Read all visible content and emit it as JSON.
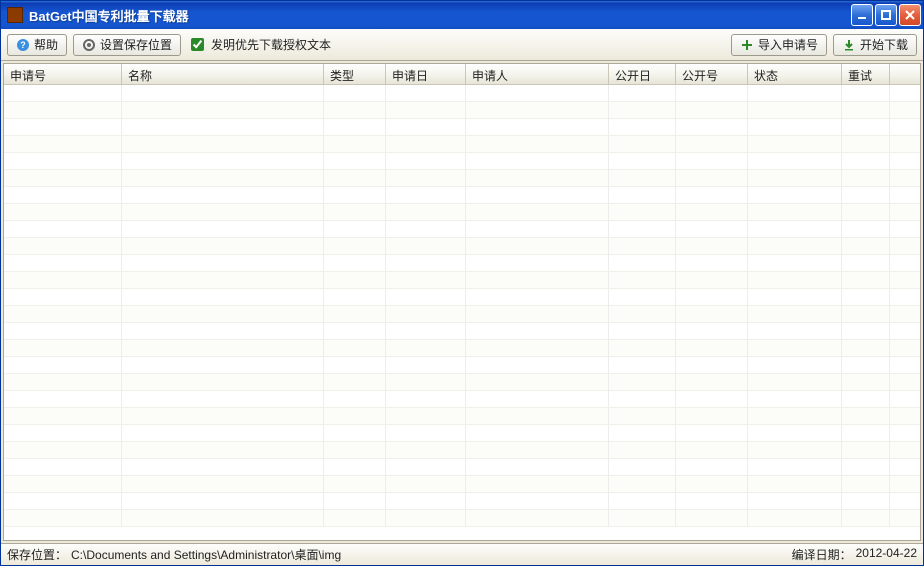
{
  "title": "BatGet中国专利批量下载器",
  "toolbar": {
    "help_label": "帮助",
    "set_path_label": "设置保存位置",
    "checkbox_label": "发明优先下载授权文本",
    "checkbox_checked": true,
    "import_label": "导入申请号",
    "start_label": "开始下载"
  },
  "columns": [
    {
      "label": "申请号"
    },
    {
      "label": "名称"
    },
    {
      "label": "类型"
    },
    {
      "label": "申请日"
    },
    {
      "label": "申请人"
    },
    {
      "label": "公开日"
    },
    {
      "label": "公开号"
    },
    {
      "label": "状态"
    },
    {
      "label": "重试"
    }
  ],
  "rows_count": 26,
  "statusbar": {
    "path_label": "保存位置：",
    "path_value": "C:\\Documents and Settings\\Administrator\\桌面\\img",
    "build_label": "编译日期：",
    "build_value": "2012-04-22"
  }
}
